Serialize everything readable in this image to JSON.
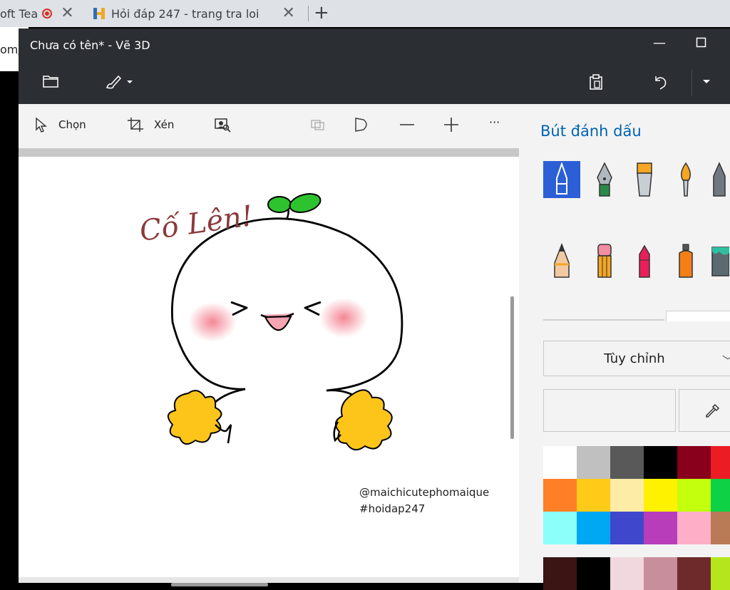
{
  "browser": {
    "tab1_title": "oft Tea",
    "tab2_title": "Hỏi đáp 247 - trang tra loi",
    "address_fragment": "om/"
  },
  "window": {
    "title": "Chưa có tên* - Vẽ 3D",
    "minimize": "—",
    "maximize": "☐"
  },
  "toolbar": {
    "select_label": "Chọn",
    "crop_label": "Xén",
    "more_label": "···"
  },
  "canvas": {
    "drawing_text": "Cố Lên!",
    "credit_line1": "@maichicutephomaique",
    "credit_line2": "#hoidap247"
  },
  "panel": {
    "title": "Bút đánh dấu",
    "dropdown_label": "Tùy chỉnh",
    "brushes": [
      "marker",
      "calligraphy-pen",
      "oil-brush",
      "watercolor",
      "pencil",
      "eraser",
      "crayon",
      "spray-can",
      "fill"
    ],
    "palette_row1": [
      "#ffffff",
      "#c0c0c0",
      "#595959",
      "#000000",
      "#88001b",
      "#ec1c24"
    ],
    "palette_row2": [
      "#ff7f27",
      "#ffca18",
      "#fdeca6",
      "#fff200",
      "#c4ff0e",
      "#0ed145"
    ],
    "palette_row3": [
      "#8cfffb",
      "#00a8f3",
      "#3f48cc",
      "#b83dba",
      "#ffaec8",
      "#b97a56"
    ],
    "custom_row": [
      "#3b1414",
      "#000000",
      "#f0d8de",
      "#c98e9b",
      "#6e2a2a",
      "#b5e61d"
    ]
  }
}
